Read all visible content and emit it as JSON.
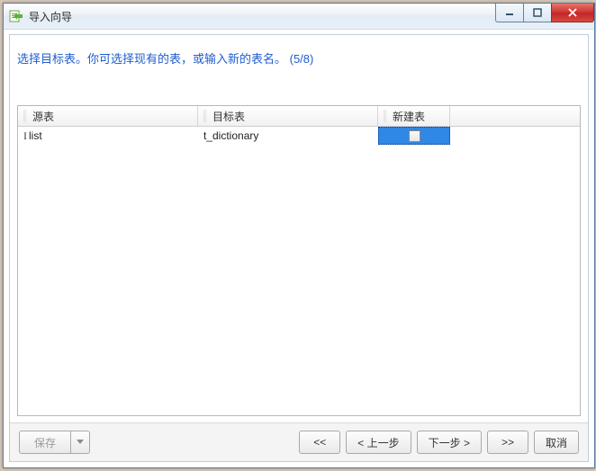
{
  "window": {
    "title": "导入向导"
  },
  "instruction": "选择目标表。你可选择现有的表，或输入新的表名。 (5/8)",
  "table": {
    "headers": {
      "source": "源表",
      "target": "目标表",
      "new": "新建表"
    },
    "rows": [
      {
        "source": "list",
        "target": "t_dictionary",
        "new_checked": false
      }
    ]
  },
  "footer": {
    "save": "保存",
    "first": "<<",
    "prev": "< 上一步",
    "next": "下一步 >",
    "last": ">>",
    "cancel": "取消"
  }
}
